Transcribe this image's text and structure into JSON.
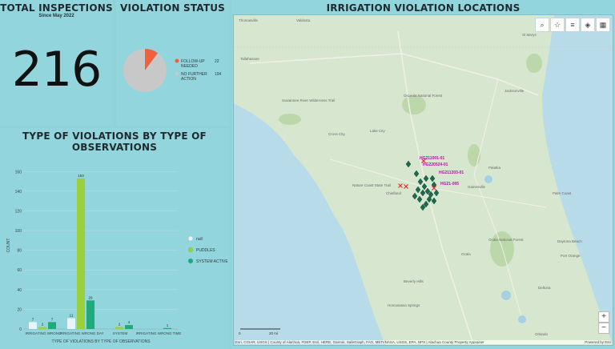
{
  "total": {
    "title": "TOTAL INSPECTIONS",
    "subtitle": "Since May 2022",
    "value": "216"
  },
  "status": {
    "title": "VIOLATION STATUS",
    "slices": [
      {
        "label": "FOLLOW-UP",
        "value": 22,
        "sub": "NEEDED",
        "color": "#f0603a"
      },
      {
        "label": "NO FURTHER",
        "value": 194,
        "sub": "ACTION",
        "color": "#c8c8c8"
      }
    ]
  },
  "types": {
    "title": "TYPE OF VIOLATIONS BY TYPE OF OBSERVATIONS",
    "chart_data": {
      "type": "bar",
      "categories": [
        "IRRIGATING WRONG",
        "IRRIGATING WRONG DAY",
        "SYSTEM",
        "IRRIGATING WRONG TIME"
      ],
      "series": [
        {
          "name": "null",
          "color": "#e8f4f5",
          "values": [
            7,
            11,
            0,
            0
          ]
        },
        {
          "name": "PUDDLES",
          "color": "#9ad03c",
          "values": [
            2,
            153,
            2,
            0
          ]
        },
        {
          "name": "SYSTEM ACTIVE",
          "color": "#1faa7c",
          "values": [
            7,
            29,
            4,
            1
          ]
        }
      ],
      "xlabel": "TYPE OF VIOLATIONS BY TYPE OF OBSERVATIONS",
      "ylabel": "COUNT",
      "yticks": [
        0,
        20,
        40,
        60,
        80,
        100,
        120,
        140,
        160
      ],
      "ylim": [
        0,
        170
      ]
    }
  },
  "map": {
    "title": "IRRIGATION VIOLATION LOCATIONS",
    "toolbar": [
      "⌕",
      "☆",
      "≡",
      "◈",
      "▦"
    ],
    "zoom_in": "+",
    "zoom_out": "−",
    "scale_left": "0",
    "scale_right": "20 mi",
    "attribution": "Esri, CGIAR, USGS | County of Alachua, FDEP, Esri, HERE, Garmin, SafeGraph, FAO, METI/NASA, USGS, EPA, NPS | Alachua County Property Appraiser",
    "powered": "Powered by Esri",
    "place_labels": [
      "Thomasville",
      "Valdosta",
      "Tallahassee",
      "Jacksonville",
      "St Marys",
      "Suwannee River Wilderness Trail",
      "Osceola National Forest",
      "Lake City",
      "Gainesville",
      "Ocala",
      "Palm Coast",
      "Daytona Beach",
      "Ocala National Forest",
      "Beverly Hills",
      "Homosassa Springs",
      "Orlando",
      "Deltona",
      "Nature Coast State Trail",
      "Port Orange",
      "Cross City",
      "Chiefland",
      "Palatka"
    ],
    "pin_labels": [
      "HG211001-01",
      "HG220524-01",
      "HG211203-01",
      "HG21-005"
    ]
  }
}
